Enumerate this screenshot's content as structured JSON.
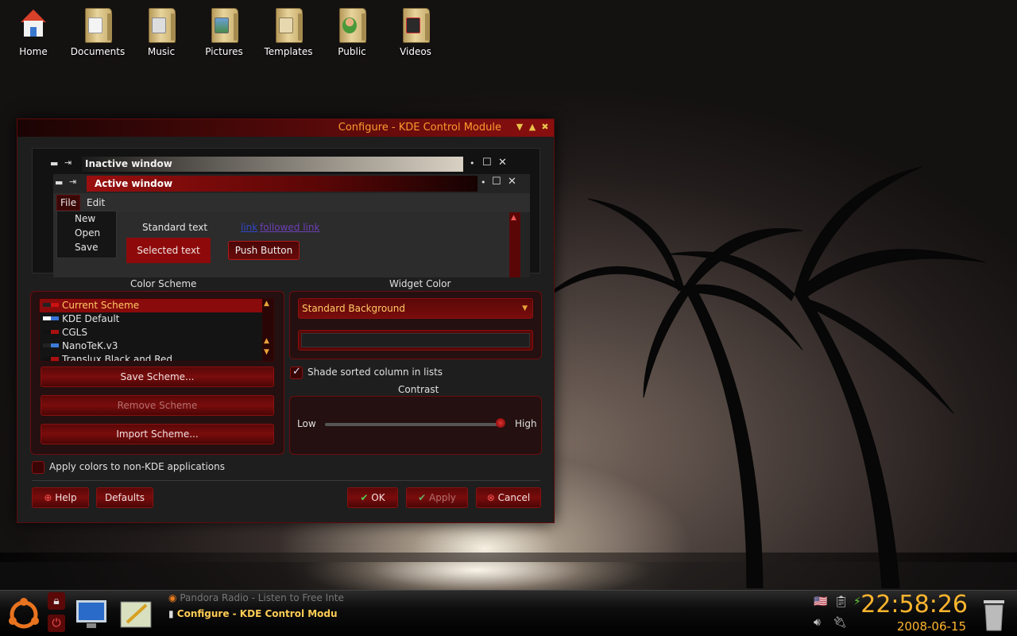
{
  "desktop": {
    "icons": [
      {
        "label": "Home",
        "icon": "home-icon"
      },
      {
        "label": "Documents",
        "icon": "folder-documents-icon"
      },
      {
        "label": "Music",
        "icon": "folder-music-icon"
      },
      {
        "label": "Pictures",
        "icon": "folder-pictures-icon"
      },
      {
        "label": "Templates",
        "icon": "folder-templates-icon"
      },
      {
        "label": "Public",
        "icon": "folder-public-icon"
      },
      {
        "label": "Videos",
        "icon": "folder-videos-icon"
      }
    ]
  },
  "window": {
    "title": "Configure - KDE Control Module",
    "preview": {
      "inactive_title": "Inactive window",
      "active_title": "Active window",
      "menu": [
        "File",
        "Edit"
      ],
      "file_menu_items": [
        "New",
        "Open",
        "Save"
      ],
      "standard_text": "Standard text",
      "selected_text": "Selected text",
      "link": "link",
      "followed_link": "followed link",
      "push_button": "Push Button"
    },
    "color_scheme": {
      "label": "Color Scheme",
      "items": [
        {
          "name": "Current Scheme",
          "selected": true,
          "swatch": [
            "#222222",
            "#cc1111"
          ]
        },
        {
          "name": "KDE Default",
          "selected": false,
          "swatch": [
            "#ffffff",
            "#3b74d8"
          ]
        },
        {
          "name": "CGLS",
          "selected": false,
          "swatch": [
            "#111111",
            "#aa1111"
          ]
        },
        {
          "name": "NanoTeK.v3",
          "selected": false,
          "swatch": [
            "#222222",
            "#3b7bd8"
          ]
        },
        {
          "name": "Translux Black and Red",
          "selected": false,
          "swatch": [
            "#111111",
            "#aa1111"
          ]
        }
      ],
      "save_button": "Save Scheme...",
      "remove_button": "Remove Scheme",
      "import_button": "Import Scheme..."
    },
    "widget_color": {
      "label": "Widget Color",
      "selected": "Standard Background"
    },
    "shade_sorted": {
      "label": "Shade sorted column in lists",
      "checked": true
    },
    "contrast": {
      "label": "Contrast",
      "low": "Low",
      "high": "High",
      "level": 0.98
    },
    "apply_colors": {
      "label": "Apply colors to non-KDE applications",
      "checked": false
    },
    "buttons": {
      "help": "Help",
      "defaults": "Defaults",
      "ok": "OK",
      "apply": "Apply",
      "cancel": "Cancel"
    }
  },
  "taskbar": {
    "tasks": [
      {
        "label": "Pandora Radio - Listen to Free Inte",
        "active": false
      },
      {
        "label": "Configure - KDE Control Modu",
        "active": true
      }
    ],
    "clock": "22:58:26",
    "date": "2008-06-15"
  },
  "colors": {
    "accent": "#8a0b0b",
    "title_text": "#ff9a2e",
    "clock": "#ffb52e"
  }
}
